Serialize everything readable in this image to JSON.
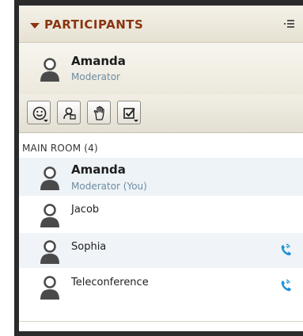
{
  "panel": {
    "title": "PARTICIPANTS",
    "menu_icon": "options-menu-icon"
  },
  "current_user": {
    "name": "Amanda",
    "role": "Moderator"
  },
  "toolbar": {
    "buttons": [
      {
        "name": "emoticon-status-button",
        "icon": "smiley-icon"
      },
      {
        "name": "presenter-button",
        "icon": "presenter-icon"
      },
      {
        "name": "raise-hand-button",
        "icon": "hand-icon"
      },
      {
        "name": "agree-button",
        "icon": "checkbox-icon"
      }
    ]
  },
  "room": {
    "label": "MAIN ROOM (4)",
    "participants": [
      {
        "name": "Amanda",
        "role": "Moderator (You)",
        "phone": false
      },
      {
        "name": "Jacob",
        "role": "",
        "phone": false
      },
      {
        "name": "Sophia",
        "role": "",
        "phone": true
      },
      {
        "name": "Teleconference",
        "role": "",
        "phone": true
      }
    ]
  },
  "colors": {
    "title": "#8a3510",
    "role": "#6e8ca0",
    "phone": "#1e90d6"
  }
}
